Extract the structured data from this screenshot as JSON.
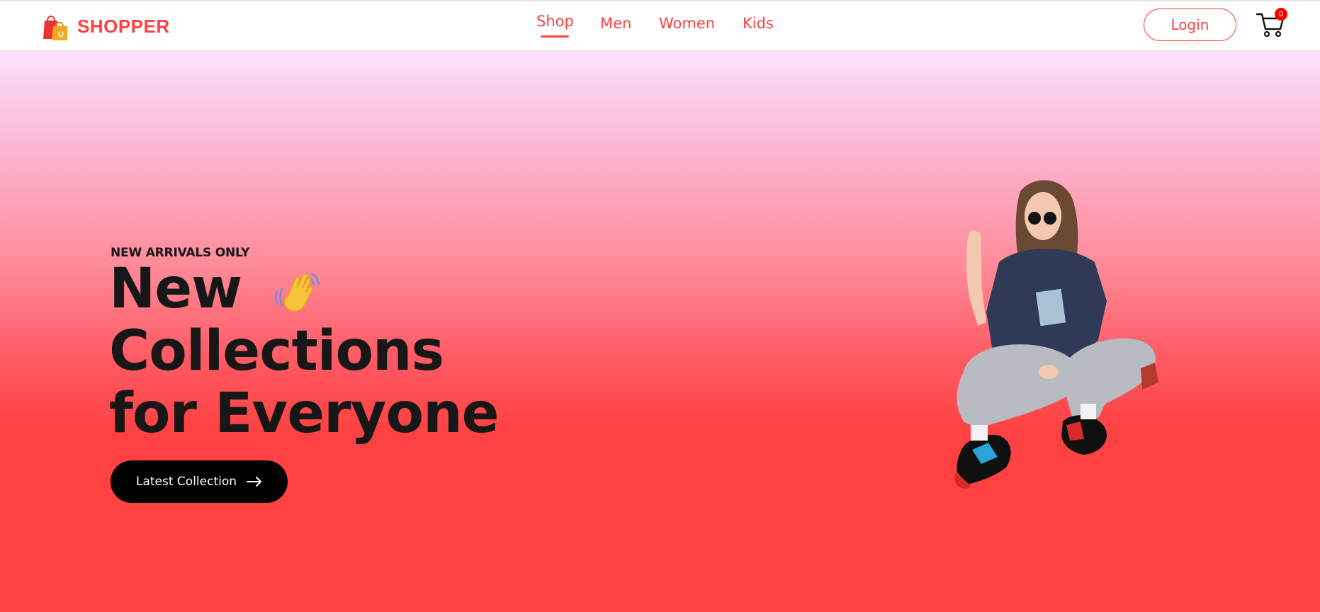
{
  "brand": {
    "name": "SHOPPER",
    "accent": "#ff4141"
  },
  "nav": {
    "items": [
      {
        "label": "Shop",
        "active": true
      },
      {
        "label": "Men",
        "active": false
      },
      {
        "label": "Women",
        "active": false
      },
      {
        "label": "Kids",
        "active": false
      }
    ]
  },
  "header": {
    "login_label": "Login",
    "cart_count": "0",
    "cart_icon": "cart-icon"
  },
  "hero": {
    "eyebrow": "NEW ARRIVALS ONLY",
    "headline_line1": "New",
    "headline_line2": "Collections",
    "headline_line3": "for Everyone",
    "wave_icon": "waving-hand-icon",
    "cta_label": "Latest Collection",
    "cta_icon": "arrow-right-icon"
  },
  "colors": {
    "primary": "#ff4141",
    "dark": "#171717",
    "button": "#000000"
  }
}
